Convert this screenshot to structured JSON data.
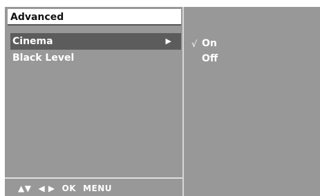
{
  "panel": {
    "title": "Advanced"
  },
  "menu": {
    "items": [
      {
        "label": "Cinema",
        "selected": true,
        "has_submenu": true,
        "arrow": "▶"
      },
      {
        "label": "Black Level",
        "selected": false,
        "has_submenu": false
      }
    ]
  },
  "submenu": {
    "options": [
      {
        "label": "On",
        "checked": true,
        "check_mark": "√"
      },
      {
        "label": "Off",
        "checked": false
      }
    ]
  },
  "footer": {
    "up_down": "▲▼",
    "left_right": "◀ ▶",
    "ok": "OK",
    "menu": "MENU"
  },
  "colors": {
    "background": "#989898",
    "highlight": "#5c5c5c",
    "title_bar": "#ffffff",
    "text": "#ffffff"
  }
}
